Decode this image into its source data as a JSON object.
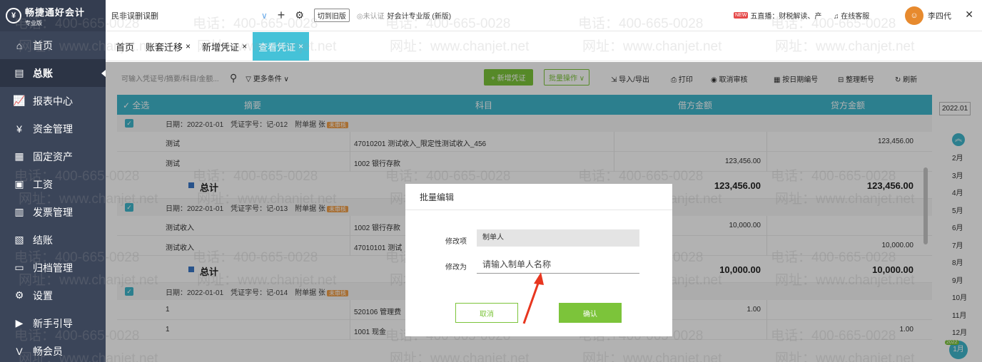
{
  "app": {
    "brand_name": "畅捷通好会计",
    "brand_edition": "专业版",
    "account_name": "民非误删误删",
    "switch_old_label": "切到旧版",
    "cert_label": "未认证",
    "edition_label": "好会计专业版 (新版)",
    "new_badge": "NEW",
    "live_label": "五直播：财税解读、产",
    "service_label": "在线客服",
    "username": "李四代"
  },
  "sidebar": {
    "items": [
      {
        "label": "首页",
        "icon": "home-icon",
        "glyph": "⌂"
      },
      {
        "label": "总账",
        "icon": "ledger-icon",
        "glyph": "▤"
      },
      {
        "label": "报表中心",
        "icon": "chart-icon",
        "glyph": "📈"
      },
      {
        "label": "资金管理",
        "icon": "money-icon",
        "glyph": "¥"
      },
      {
        "label": "固定资产",
        "icon": "asset-icon",
        "glyph": "▦"
      },
      {
        "label": "工资",
        "icon": "salary-icon",
        "glyph": "▣"
      },
      {
        "label": "发票管理",
        "icon": "invoice-icon",
        "glyph": "▥"
      },
      {
        "label": "结账",
        "icon": "close-books-icon",
        "glyph": "▧"
      },
      {
        "label": "归档管理",
        "icon": "archive-icon",
        "glyph": "▭"
      },
      {
        "label": "设置",
        "icon": "gear-icon",
        "glyph": "⚙"
      },
      {
        "label": "新手引导",
        "icon": "guide-icon",
        "glyph": "▶"
      },
      {
        "label": "畅会员",
        "icon": "vip-icon",
        "glyph": "V"
      }
    ]
  },
  "tabs": [
    {
      "label": "首页",
      "closable": false
    },
    {
      "label": "账套迁移",
      "closable": true
    },
    {
      "label": "新增凭证",
      "closable": true
    },
    {
      "label": "查看凭证",
      "closable": true,
      "active": true
    }
  ],
  "toolbar": {
    "search_placeholder": "可输入凭证号/摘要/科目/金额...",
    "more_label": "更多条件",
    "new_label": "+ 新增凭证",
    "batch_label": "批量操作",
    "import_export": "导入/导出",
    "print": "打印",
    "unaudit": "取消审核",
    "by_date": "按日期编号",
    "renumber": "整理断号",
    "refresh": "刷新"
  },
  "table": {
    "headers": [
      "全选",
      "摘要",
      "科目",
      "借方金额",
      "贷方金额"
    ],
    "total_label": "总计",
    "groups": [
      {
        "info": "日期：2022-01-01　凭证字号：记-012　附单据 张",
        "status": "未审核",
        "rows": [
          {
            "summary": "测试",
            "subject": "47010201 测试收入_限定性测试收入_456",
            "debit": "",
            "credit": "123,456.00"
          },
          {
            "summary": "测试",
            "subject": "1002 银行存款",
            "debit": "123,456.00",
            "credit": ""
          }
        ],
        "total_debit": "123,456.00",
        "total_credit": "123,456.00"
      },
      {
        "info": "日期：2022-01-01　凭证字号：记-013　附单据 张",
        "status": "未审核",
        "rows": [
          {
            "summary": "测试收入",
            "subject": "1002 银行存款",
            "debit": "10,000.00",
            "credit": ""
          },
          {
            "summary": "测试收入",
            "subject": "47010101 测试",
            "debit": "",
            "credit": "10,000.00"
          }
        ],
        "total_debit": "10,000.00",
        "total_credit": "10,000.00"
      },
      {
        "info": "日期：2022-01-01　凭证字号：记-014　附单据 张",
        "status": "未审核",
        "rows": [
          {
            "summary": "1",
            "subject": "520106 管理费",
            "debit": "1.00",
            "credit": ""
          },
          {
            "summary": "1",
            "subject": "1001 现金",
            "debit": "",
            "credit": "1.00"
          }
        ]
      }
    ]
  },
  "periods": {
    "year": "2022.01",
    "months": [
      "2月",
      "3月",
      "4月",
      "5月",
      "6月",
      "7月",
      "8月",
      "9月",
      "10月",
      "11月",
      "12月"
    ],
    "current_year": "2022",
    "current_month": "1月"
  },
  "modal": {
    "title": "批量编辑",
    "item_label": "修改项",
    "item_value": "制单人",
    "to_label": "修改为",
    "to_placeholder": "请输入制单人名称",
    "cancel_label": "取消",
    "confirm_label": "确认"
  },
  "watermark": {
    "phone": "电话：400-665-0028",
    "site": "网址：www.chanjet.net"
  },
  "colors": {
    "sidebar": "#3b4559",
    "accent": "#3fb7cc",
    "green": "#7cc43a",
    "badge": "#f0a04b"
  }
}
